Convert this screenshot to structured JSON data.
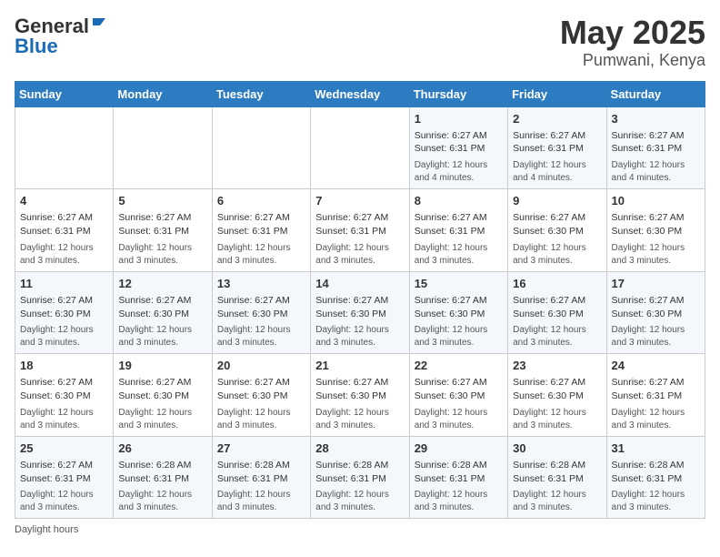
{
  "header": {
    "logo_general": "General",
    "logo_blue": "Blue",
    "title": "May 2025",
    "subtitle": "Pumwani, Kenya"
  },
  "columns": [
    "Sunday",
    "Monday",
    "Tuesday",
    "Wednesday",
    "Thursday",
    "Friday",
    "Saturday"
  ],
  "weeks": [
    [
      {
        "day": "",
        "sunrise": "",
        "sunset": "",
        "daylight": ""
      },
      {
        "day": "",
        "sunrise": "",
        "sunset": "",
        "daylight": ""
      },
      {
        "day": "",
        "sunrise": "",
        "sunset": "",
        "daylight": ""
      },
      {
        "day": "",
        "sunrise": "",
        "sunset": "",
        "daylight": ""
      },
      {
        "day": "1",
        "sunrise": "Sunrise: 6:27 AM",
        "sunset": "Sunset: 6:31 PM",
        "daylight": "Daylight: 12 hours and 4 minutes."
      },
      {
        "day": "2",
        "sunrise": "Sunrise: 6:27 AM",
        "sunset": "Sunset: 6:31 PM",
        "daylight": "Daylight: 12 hours and 4 minutes."
      },
      {
        "day": "3",
        "sunrise": "Sunrise: 6:27 AM",
        "sunset": "Sunset: 6:31 PM",
        "daylight": "Daylight: 12 hours and 4 minutes."
      }
    ],
    [
      {
        "day": "4",
        "sunrise": "Sunrise: 6:27 AM",
        "sunset": "Sunset: 6:31 PM",
        "daylight": "Daylight: 12 hours and 3 minutes."
      },
      {
        "day": "5",
        "sunrise": "Sunrise: 6:27 AM",
        "sunset": "Sunset: 6:31 PM",
        "daylight": "Daylight: 12 hours and 3 minutes."
      },
      {
        "day": "6",
        "sunrise": "Sunrise: 6:27 AM",
        "sunset": "Sunset: 6:31 PM",
        "daylight": "Daylight: 12 hours and 3 minutes."
      },
      {
        "day": "7",
        "sunrise": "Sunrise: 6:27 AM",
        "sunset": "Sunset: 6:31 PM",
        "daylight": "Daylight: 12 hours and 3 minutes."
      },
      {
        "day": "8",
        "sunrise": "Sunrise: 6:27 AM",
        "sunset": "Sunset: 6:31 PM",
        "daylight": "Daylight: 12 hours and 3 minutes."
      },
      {
        "day": "9",
        "sunrise": "Sunrise: 6:27 AM",
        "sunset": "Sunset: 6:30 PM",
        "daylight": "Daylight: 12 hours and 3 minutes."
      },
      {
        "day": "10",
        "sunrise": "Sunrise: 6:27 AM",
        "sunset": "Sunset: 6:30 PM",
        "daylight": "Daylight: 12 hours and 3 minutes."
      }
    ],
    [
      {
        "day": "11",
        "sunrise": "Sunrise: 6:27 AM",
        "sunset": "Sunset: 6:30 PM",
        "daylight": "Daylight: 12 hours and 3 minutes."
      },
      {
        "day": "12",
        "sunrise": "Sunrise: 6:27 AM",
        "sunset": "Sunset: 6:30 PM",
        "daylight": "Daylight: 12 hours and 3 minutes."
      },
      {
        "day": "13",
        "sunrise": "Sunrise: 6:27 AM",
        "sunset": "Sunset: 6:30 PM",
        "daylight": "Daylight: 12 hours and 3 minutes."
      },
      {
        "day": "14",
        "sunrise": "Sunrise: 6:27 AM",
        "sunset": "Sunset: 6:30 PM",
        "daylight": "Daylight: 12 hours and 3 minutes."
      },
      {
        "day": "15",
        "sunrise": "Sunrise: 6:27 AM",
        "sunset": "Sunset: 6:30 PM",
        "daylight": "Daylight: 12 hours and 3 minutes."
      },
      {
        "day": "16",
        "sunrise": "Sunrise: 6:27 AM",
        "sunset": "Sunset: 6:30 PM",
        "daylight": "Daylight: 12 hours and 3 minutes."
      },
      {
        "day": "17",
        "sunrise": "Sunrise: 6:27 AM",
        "sunset": "Sunset: 6:30 PM",
        "daylight": "Daylight: 12 hours and 3 minutes."
      }
    ],
    [
      {
        "day": "18",
        "sunrise": "Sunrise: 6:27 AM",
        "sunset": "Sunset: 6:30 PM",
        "daylight": "Daylight: 12 hours and 3 minutes."
      },
      {
        "day": "19",
        "sunrise": "Sunrise: 6:27 AM",
        "sunset": "Sunset: 6:30 PM",
        "daylight": "Daylight: 12 hours and 3 minutes."
      },
      {
        "day": "20",
        "sunrise": "Sunrise: 6:27 AM",
        "sunset": "Sunset: 6:30 PM",
        "daylight": "Daylight: 12 hours and 3 minutes."
      },
      {
        "day": "21",
        "sunrise": "Sunrise: 6:27 AM",
        "sunset": "Sunset: 6:30 PM",
        "daylight": "Daylight: 12 hours and 3 minutes."
      },
      {
        "day": "22",
        "sunrise": "Sunrise: 6:27 AM",
        "sunset": "Sunset: 6:30 PM",
        "daylight": "Daylight: 12 hours and 3 minutes."
      },
      {
        "day": "23",
        "sunrise": "Sunrise: 6:27 AM",
        "sunset": "Sunset: 6:30 PM",
        "daylight": "Daylight: 12 hours and 3 minutes."
      },
      {
        "day": "24",
        "sunrise": "Sunrise: 6:27 AM",
        "sunset": "Sunset: 6:31 PM",
        "daylight": "Daylight: 12 hours and 3 minutes."
      }
    ],
    [
      {
        "day": "25",
        "sunrise": "Sunrise: 6:27 AM",
        "sunset": "Sunset: 6:31 PM",
        "daylight": "Daylight: 12 hours and 3 minutes."
      },
      {
        "day": "26",
        "sunrise": "Sunrise: 6:28 AM",
        "sunset": "Sunset: 6:31 PM",
        "daylight": "Daylight: 12 hours and 3 minutes."
      },
      {
        "day": "27",
        "sunrise": "Sunrise: 6:28 AM",
        "sunset": "Sunset: 6:31 PM",
        "daylight": "Daylight: 12 hours and 3 minutes."
      },
      {
        "day": "28",
        "sunrise": "Sunrise: 6:28 AM",
        "sunset": "Sunset: 6:31 PM",
        "daylight": "Daylight: 12 hours and 3 minutes."
      },
      {
        "day": "29",
        "sunrise": "Sunrise: 6:28 AM",
        "sunset": "Sunset: 6:31 PM",
        "daylight": "Daylight: 12 hours and 3 minutes."
      },
      {
        "day": "30",
        "sunrise": "Sunrise: 6:28 AM",
        "sunset": "Sunset: 6:31 PM",
        "daylight": "Daylight: 12 hours and 3 minutes."
      },
      {
        "day": "31",
        "sunrise": "Sunrise: 6:28 AM",
        "sunset": "Sunset: 6:31 PM",
        "daylight": "Daylight: 12 hours and 3 minutes."
      }
    ]
  ],
  "footer": {
    "daylight_hours": "Daylight hours"
  }
}
